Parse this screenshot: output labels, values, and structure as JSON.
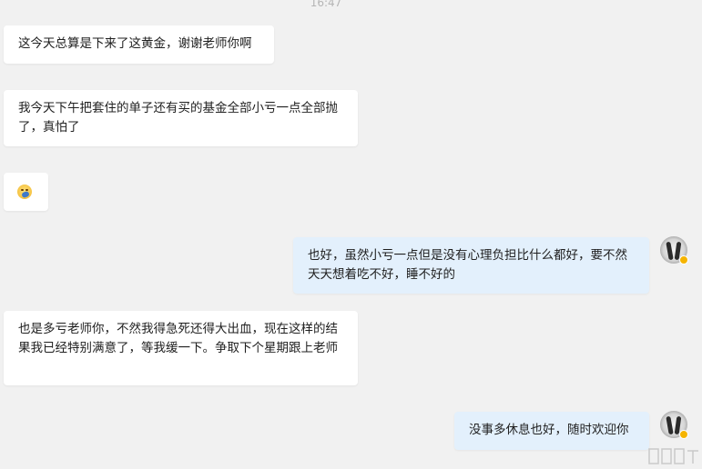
{
  "chat": {
    "timestamp": "16:47",
    "messages": [
      {
        "side": "incoming",
        "text": "这今天总算是下来了这黄金，谢谢老师你啊"
      },
      {
        "side": "incoming",
        "text": "我今天下午把套住的单子还有买的基金全部小亏一点全部抛了，真怕了"
      },
      {
        "side": "incoming",
        "emoji": "facepalm-emoji"
      },
      {
        "side": "outgoing",
        "text": "也好，虽然小亏一点但是没有心理负担比什么都好，要不然天天想着吃不好，睡不好的"
      },
      {
        "side": "incoming",
        "text": "也是多亏老师你，不然我得急死还得大出血，现在这样的结果我已经特别满意了，等我缓一下。争取下个星期跟上老师"
      },
      {
        "side": "outgoing",
        "text": "没事多休息也好，随时欢迎你"
      }
    ]
  },
  "colors": {
    "background": "#f1f1f1",
    "incoming_bubble": "#ffffff",
    "outgoing_bubble": "#e3f0fc",
    "text": "#1f1f1f",
    "timestamp": "#b5b5b5",
    "avatar_badge": "#f5b400"
  },
  "icons": {
    "emoji": "facepalm-emoji",
    "avatar": "user-avatar",
    "badge": "verified-badge-icon"
  }
}
